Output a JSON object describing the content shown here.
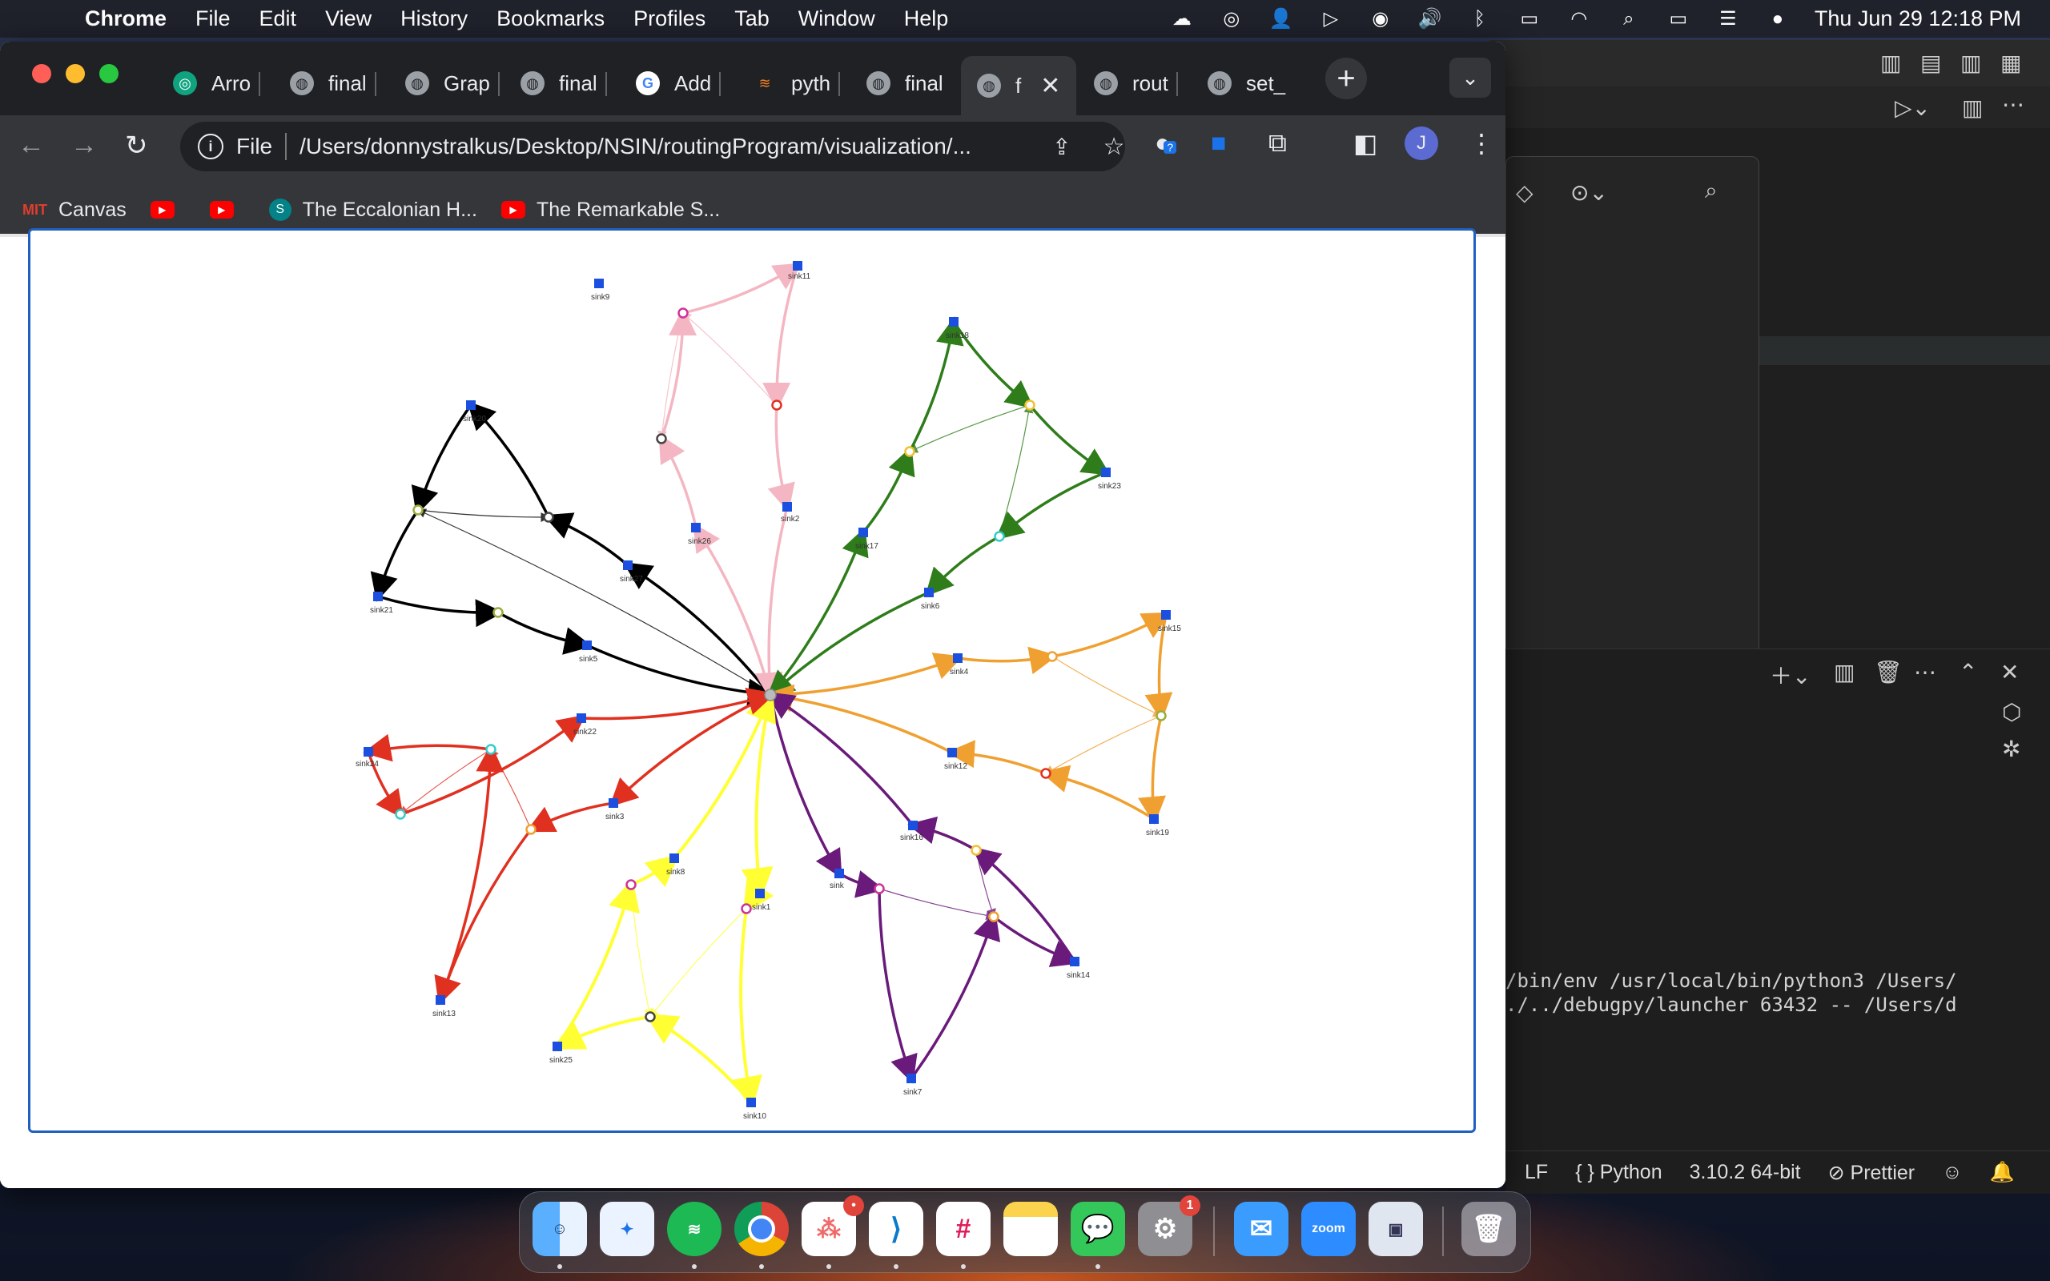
{
  "menubar": {
    "app_name": "Chrome",
    "menus": [
      "File",
      "Edit",
      "View",
      "History",
      "Bookmarks",
      "Profiles",
      "Tab",
      "Window",
      "Help"
    ],
    "clock": "Thu Jun 29  12:18 PM"
  },
  "browser": {
    "tabs": [
      {
        "label": "Arro",
        "icon": "openai-icon"
      },
      {
        "label": "final",
        "icon": "globe-icon"
      },
      {
        "label": "Grap",
        "icon": "globe-icon"
      },
      {
        "label": "final",
        "icon": "globe-icon"
      },
      {
        "label": "Add",
        "icon": "google-icon"
      },
      {
        "label": "pyth",
        "icon": "stackoverflow-icon"
      },
      {
        "label": "final",
        "icon": "globe-icon"
      },
      {
        "label": "f",
        "icon": "globe-icon",
        "active": true
      },
      {
        "label": "rout",
        "icon": "globe-icon"
      },
      {
        "label": "set_",
        "icon": "globe-icon"
      }
    ],
    "omnibox": {
      "scheme_label": "File",
      "url": "/Users/donnystralkus/Desktop/NSIN/routingProgram/visualization/..."
    },
    "profile_initial": "J",
    "extension_badge": "?",
    "bookmarks": [
      {
        "label": "Canvas",
        "icon": "canvas-icon"
      },
      {
        "label": "",
        "icon": "youtube-icon"
      },
      {
        "label": "",
        "icon": "youtube-icon"
      },
      {
        "label": "The Eccalonian H...",
        "icon": "sharepoint-icon"
      },
      {
        "label": "The Remarkable S...",
        "icon": "youtube-icon"
      }
    ]
  },
  "graph": {
    "depot_color": "#aaaaaa",
    "routes": [
      {
        "color": "#000000",
        "sinks": [
          "sink20",
          "sink27",
          "sink21",
          "sink5"
        ]
      },
      {
        "color": "#f4b6c2",
        "sinks": [
          "sink9",
          "sink11",
          "sink26",
          "sink2"
        ]
      },
      {
        "color": "#2e7d1a",
        "sinks": [
          "sink18",
          "sink23",
          "sink17",
          "sink6"
        ]
      },
      {
        "color": "#f0a030",
        "sinks": [
          "sink4",
          "sink15",
          "sink12",
          "sink19"
        ]
      },
      {
        "color": "#6a1a7a",
        "sinks": [
          "sink16",
          "sink14",
          "sink",
          "sink7"
        ]
      },
      {
        "color": "#ffff33",
        "sinks": [
          "sink8",
          "sink1",
          "sink25",
          "sink10"
        ]
      },
      {
        "color": "#e03020",
        "sinks": [
          "sink22",
          "sink24",
          "sink3",
          "sink13"
        ]
      }
    ],
    "labels": [
      "sink11",
      "sink9",
      "sink18",
      "sink20",
      "sink23",
      "sink26",
      "sink2",
      "sink17",
      "sink27",
      "sink6",
      "sink21",
      "sink5",
      "sink15",
      "sink4",
      "sink22",
      "sink24",
      "sink12",
      "sink3",
      "sink19",
      "sink16",
      "sink8",
      "sink1",
      "sink",
      "sink14",
      "sink13",
      "sink25",
      "sink7",
      "sink10"
    ]
  },
  "vscode": {
    "terminal_lines": [
      "/bin/env /usr/local/bin/python3 /Users/",
      "./../debugpy/launcher 63432 -- /Users/d"
    ],
    "status": [
      "LF",
      "Python",
      "3.10.2 64-bit",
      "Prettier"
    ]
  },
  "dock": {
    "apps": [
      "Finder",
      "Safari",
      "Spotify",
      "Chrome",
      "Asana",
      "VS Code",
      "Slack",
      "Notes",
      "Messages",
      "System Settings",
      "Mail",
      "Zoom",
      "Preview",
      "Trash"
    ],
    "zoom_label": "zoom",
    "badge_asana": "•",
    "badge_settings": "1"
  }
}
